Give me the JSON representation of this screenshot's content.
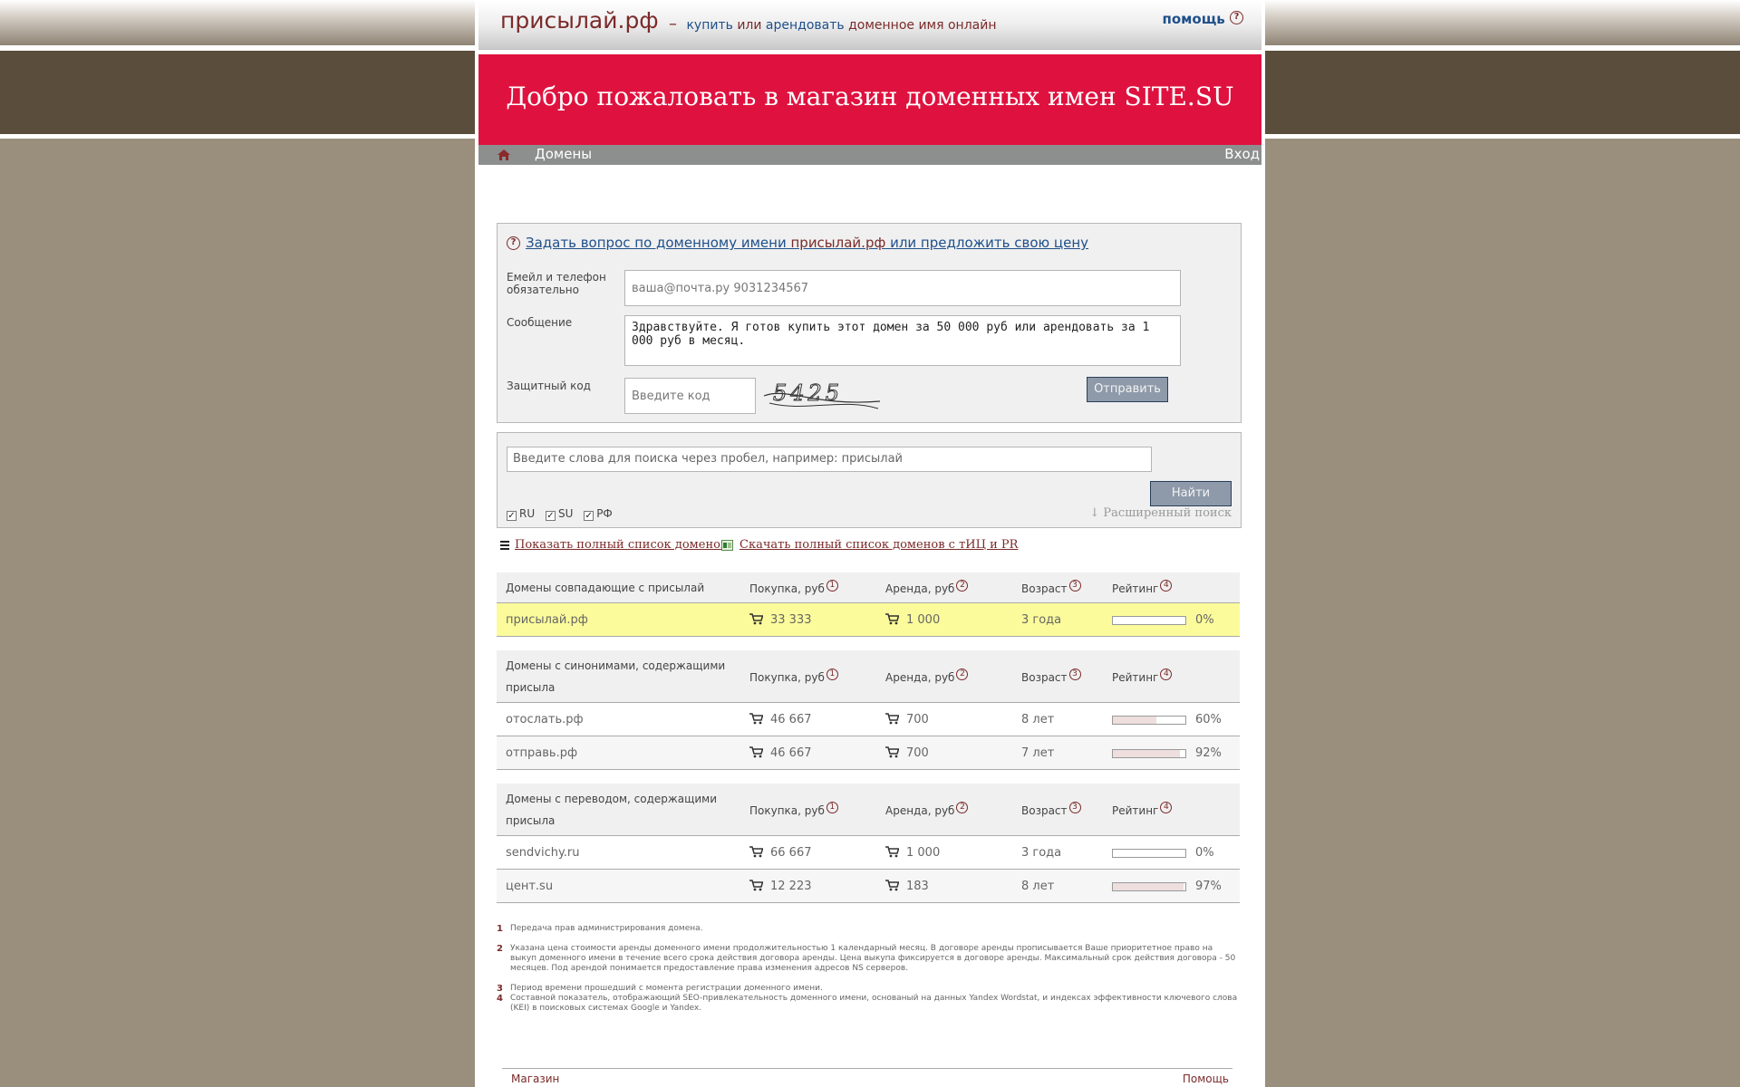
{
  "header": {
    "logo": "присылай.рф",
    "dash": "–",
    "tagline_buy": "купить",
    "tagline_or": "или",
    "tagline_rent": "арендовать",
    "tagline_rest": "доменное имя онлайн",
    "help": "помощь",
    "help_icon": "?"
  },
  "banner": {
    "title": "Добро пожаловать в магазин доменных имен SITE.SU"
  },
  "nav": {
    "domains": "Домены",
    "login": "Вход"
  },
  "question_form": {
    "title_pre": "Задать вопрос по доменному имени",
    "title_domain": "присылай.рф",
    "title_post": "или предложить свою цену",
    "email_label": "Емейл и телефон обязательно",
    "email_placeholder": "ваша@почта.ру 9031234567",
    "message_label": "Сообщение",
    "message_value": "Здравствуйте. Я готов купить этот домен за 50 000 руб или арендовать за 1 000 руб в месяц.",
    "code_label": "Защитный код",
    "code_placeholder": "Введите код",
    "captcha_text": "5425",
    "send_label": "Отправить"
  },
  "search": {
    "placeholder": "Введите слова для поиска через пробел, например: присылай",
    "find_label": "Найти",
    "zones": [
      "RU",
      "SU",
      "РФ"
    ],
    "check_mark": "✓",
    "advanced_label": "↓ Расширенный поиск"
  },
  "links": {
    "full_list": "Показать полный список доменов",
    "download": "Скачать полный список доменов с тИЦ и PR"
  },
  "columns": {
    "buy": "Покупка, руб",
    "rent": "Аренда, руб",
    "age": "Возраст",
    "rating": "Рейтинг",
    "n1": "1",
    "n2": "2",
    "n3": "3",
    "n4": "4"
  },
  "sections": [
    {
      "title_line1": "Домены совпадающие с присылай",
      "title_line2": "",
      "rows": [
        {
          "domain": "присылай.рф",
          "buy": "33 333",
          "rent": "1 000",
          "age": "3 года",
          "rating": 0,
          "rating_label": "0%"
        }
      ]
    },
    {
      "title_line1": "Домены с синонимами, содержащими",
      "title_line2": "присыла",
      "rows": [
        {
          "domain": "отослать.рф",
          "buy": "46 667",
          "rent": "700",
          "age": "8 лет",
          "rating": 60,
          "rating_label": "60%"
        },
        {
          "domain": "отправь.рф",
          "buy": "46 667",
          "rent": "700",
          "age": "7 лет",
          "rating": 92,
          "rating_label": "92%"
        }
      ]
    },
    {
      "title_line1": "Домены с переводом, содержащими",
      "title_line2": "присыла",
      "rows": [
        {
          "domain": "sendvichy.ru",
          "buy": "66 667",
          "rent": "1 000",
          "age": "3 года",
          "rating": 0,
          "rating_label": "0%"
        },
        {
          "domain": "цент.su",
          "buy": "12 223",
          "rent": "183",
          "age": "8 лет",
          "rating": 97,
          "rating_label": "97%"
        }
      ]
    }
  ],
  "notes": [
    {
      "n": "1",
      "text": "Передача прав администрирования домена."
    },
    {
      "n": "2",
      "text": "Указана цена стоимости аренды доменного имени продолжительностью 1 календарный месяц. В договоре аренды прописывается Ваше приоритетное право на выкуп доменного имени в течение всего срока действия договора аренды. Цена выкупа фиксируется в договоре аренды. Максимальный срок действия договора - 50 месяцев. Под арендой понимается предоставление права изменения адресов NS серверов."
    },
    {
      "n": "3",
      "text": "Период времени прошедший с момента регистрации доменного имени."
    },
    {
      "n": "4",
      "text": "Составной показатель, отображающий SEO-привлекательность доменного имени, основаный на данных Yandex Wordstat, и индексах эффективности ключевого слова (KEI) в поисковых системах Google и Yandex."
    }
  ],
  "footer": {
    "shop": "Магазин",
    "help": "Помощь"
  },
  "colors": {
    "banner": "#df123f",
    "brand": "#7b2a2a",
    "link": "#1e4f8a",
    "highlight": "#fbfb9b"
  }
}
